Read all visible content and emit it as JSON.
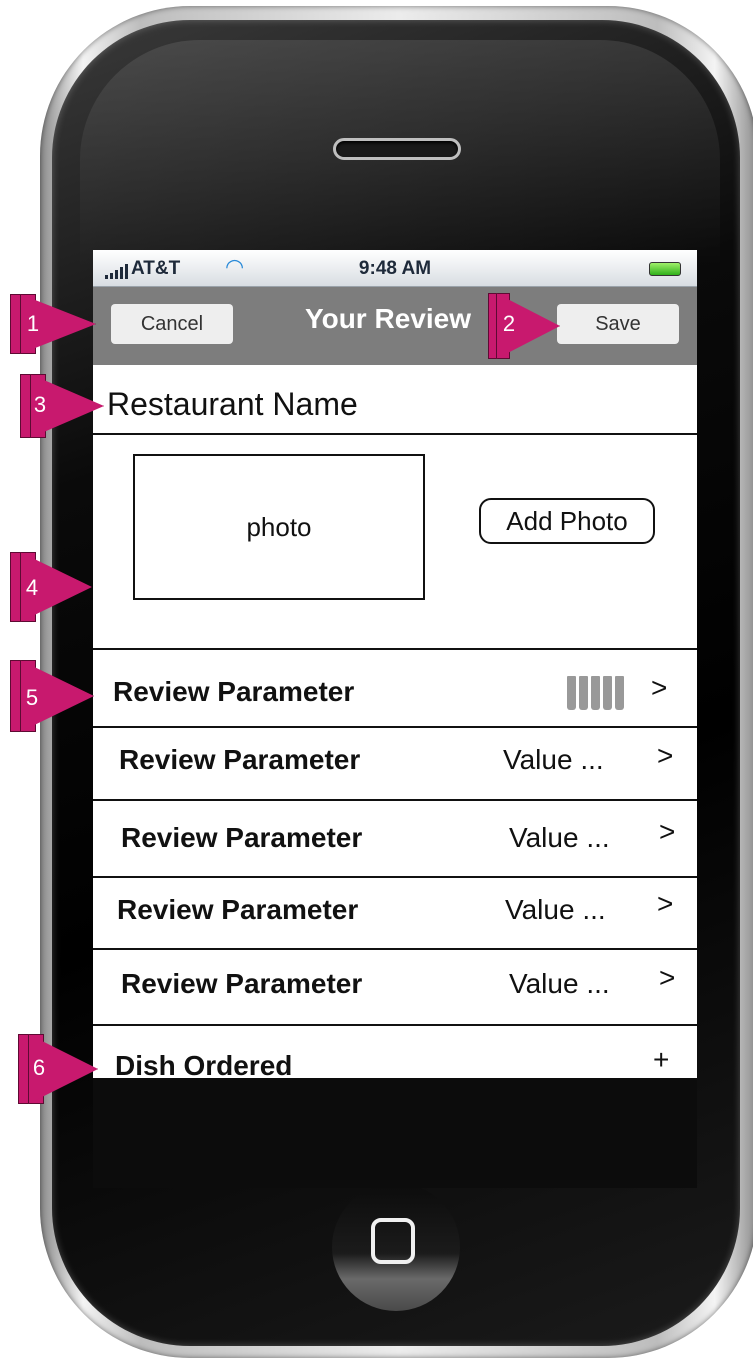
{
  "status_bar": {
    "carrier": "AT&T",
    "time": "9:48 AM"
  },
  "nav": {
    "cancel_label": "Cancel",
    "title": "Your Review",
    "save_label": "Save"
  },
  "restaurant": {
    "name": "Restaurant Name"
  },
  "photo": {
    "placeholder": "photo",
    "add_label": "Add Photo"
  },
  "review_rows": [
    {
      "label": "Review Parameter",
      "value_icon": "fork-rating-icon",
      "chevron": ">"
    },
    {
      "label": "Review Parameter",
      "value": "Value ...",
      "chevron": ">"
    },
    {
      "label": "Review Parameter",
      "value": "Value ...",
      "chevron": ">"
    },
    {
      "label": "Review Parameter",
      "value": "Value ...",
      "chevron": ">"
    },
    {
      "label": "Review Parameter",
      "value": "Value ...",
      "chevron": ">"
    }
  ],
  "dish": {
    "label": "Dish Ordered",
    "action": "+"
  },
  "callouts": [
    "1",
    "2",
    "3",
    "4",
    "5",
    "6"
  ],
  "colors": {
    "callout": "#c8196e",
    "nav_bar": "#7d7d7d",
    "nav_button": "#eeeeee"
  }
}
